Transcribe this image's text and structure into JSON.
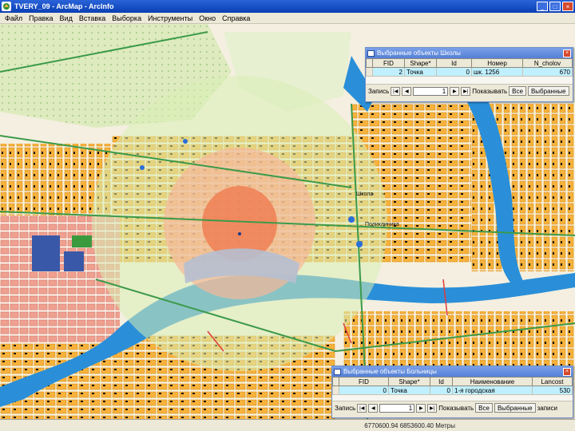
{
  "window": {
    "title": "TVERY_09 - ArcMap - ArcInfo",
    "buttons": [
      "_",
      "□",
      "×"
    ]
  },
  "menu": [
    "Файл",
    "Правка",
    "Вид",
    "Вставка",
    "Выборка",
    "Инструменты",
    "Окно",
    "Справка"
  ],
  "map": {
    "labels": [
      "Школа",
      "Поликлиника"
    ]
  },
  "schools_panel": {
    "title": "Выбранные объекты Школы",
    "columns": [
      "FID",
      "Shape*",
      "Id",
      "Номер",
      "N_cholov"
    ],
    "rows": [
      [
        "2",
        "Точка",
        "0",
        "шк. 1256",
        "670"
      ]
    ],
    "nav": {
      "label": "Запись",
      "value": "1",
      "show_label": "Показывать",
      "all_btn": "Все",
      "selected_btn": "Выбранные"
    }
  },
  "hospitals_panel": {
    "title": "Выбранные объекты Больницы",
    "columns": [
      "FID",
      "Shape*",
      "Id",
      "Наименование",
      "Lancost"
    ],
    "rows": [
      [
        "0",
        "Точка",
        "0",
        "1-я городская",
        "530"
      ]
    ],
    "nav": {
      "label": "Запись",
      "value": "1",
      "show_label": "Показывать",
      "all_btn": "Все",
      "selected_btn": "Выбранные",
      "records_label": "записи"
    }
  },
  "status": {
    "coords": "6770600.94 6853600.40 Метры"
  },
  "colors": {
    "title_bar": "#0a3fb5",
    "river": "#2a8fd8",
    "block": "#f7b23c",
    "buffer_inner": "#f07a50",
    "buffer_middle": "#f5b89a",
    "buffer_outer": "#d9efb5",
    "selection_cell": "#c0f0ff"
  }
}
